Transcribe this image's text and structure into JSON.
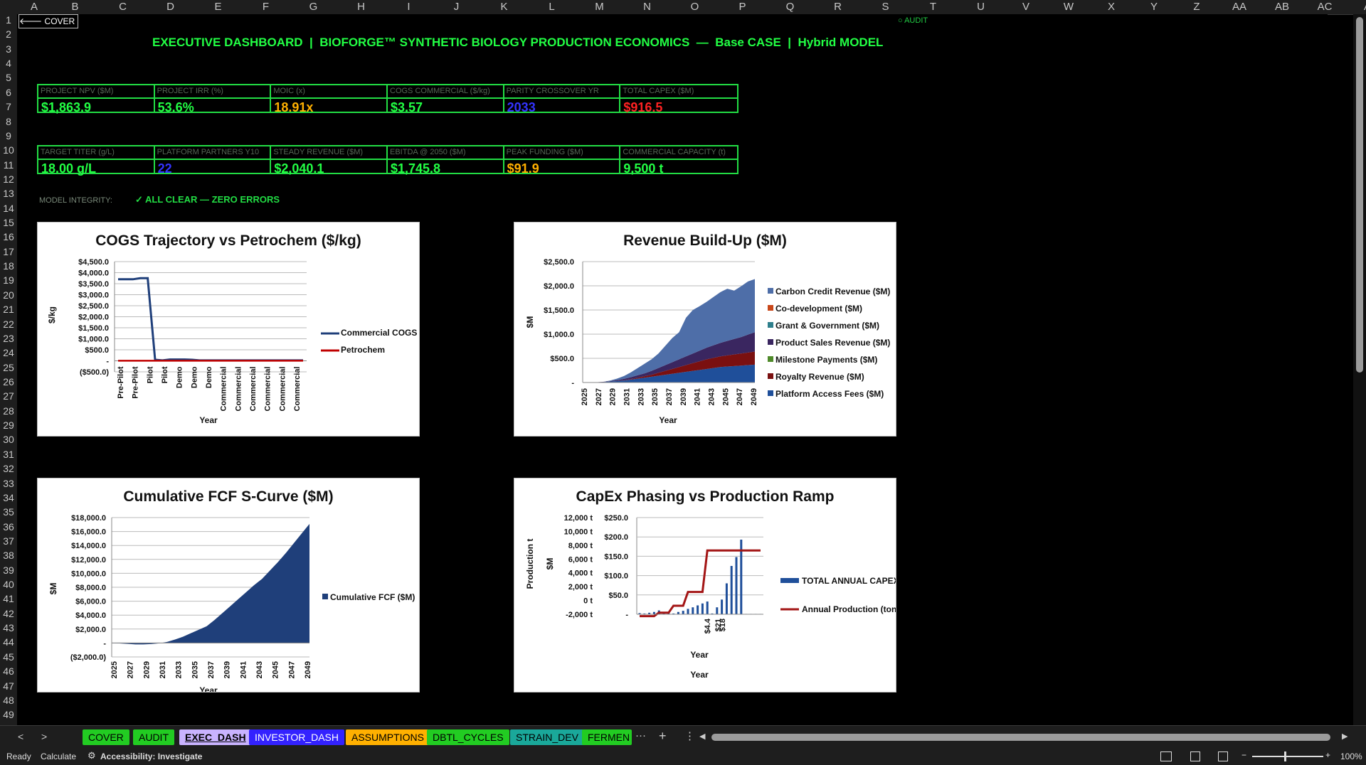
{
  "columns": [
    "A",
    "B",
    "C",
    "D",
    "E",
    "F",
    "G",
    "H",
    "I",
    "J",
    "K",
    "L",
    "M",
    "N",
    "O",
    "P",
    "Q",
    "R",
    "S",
    "T",
    "U",
    "V",
    "W",
    "X",
    "Y",
    "Z",
    "AA",
    "AB",
    "AC",
    "A"
  ],
  "rows": [
    "1",
    "2",
    "3",
    "4",
    "5",
    "6",
    "7",
    "8",
    "9",
    "10",
    "11",
    "12",
    "13",
    "14",
    "15",
    "16",
    "17",
    "18",
    "19",
    "20",
    "21",
    "22",
    "23",
    "24",
    "25",
    "26",
    "27",
    "28",
    "29",
    "30",
    "31",
    "32",
    "33",
    "34",
    "35",
    "36",
    "37",
    "38",
    "39",
    "40",
    "41",
    "42",
    "43",
    "44",
    "45",
    "46",
    "47",
    "48",
    "49"
  ],
  "nav": {
    "back_label": "COVER",
    "audit_label": "○ AUDIT"
  },
  "title": "EXECUTIVE DASHBOARD  |  BIOFORGE™ SYNTHETIC BIOLOGY PRODUCTION ECONOMICS  —  Base CASE  |  Hybrid MODEL",
  "kpi_row1": [
    {
      "label": "PROJECT NPV ($M)",
      "value": "$1,863.9",
      "color": "#22ff44"
    },
    {
      "label": "PROJECT IRR (%)",
      "value": "53.6%",
      "color": "#22ff44"
    },
    {
      "label": "MOIC (x)",
      "value": "18.91x",
      "color": "#ffb000"
    },
    {
      "label": "COGS COMMERCIAL ($/kg)",
      "value": "$3.57",
      "color": "#22ff44"
    },
    {
      "label": "PARITY CROSSOVER YR",
      "value": "2033",
      "color": "#3333ff"
    },
    {
      "label": "TOTAL CAPEX ($M)",
      "value": "$916.5",
      "color": "#ff2222"
    }
  ],
  "kpi_row2": [
    {
      "label": "TARGET TITER (g/L)",
      "value": "18.00 g/L",
      "color": "#22ff44"
    },
    {
      "label": "PLATFORM PARTNERS Y10",
      "value": "22",
      "color": "#3333ff"
    },
    {
      "label": "STEADY REVENUE ($M)",
      "value": "$2,040.1",
      "color": "#22ff44"
    },
    {
      "label": "EBITDA @ 2050 ($M)",
      "value": "$1,745.8",
      "color": "#22ff44"
    },
    {
      "label": "PEAK FUNDING ($M)",
      "value": "$91.9",
      "color": "#ffb000"
    },
    {
      "label": "COMMERCIAL CAPACITY (t)",
      "value": "9,500 t",
      "color": "#22ff44"
    }
  ],
  "integrity": {
    "label": "MODEL INTEGRITY:",
    "value": "✓ ALL CLEAR — ZERO ERRORS"
  },
  "colors": {
    "green": "#22ff44",
    "navy": "#1f3f7a",
    "red": "#c00000",
    "accent": "#22dd44"
  },
  "chart_data": [
    {
      "type": "line",
      "title": "COGS Trajectory vs Petrochem ($/kg)",
      "xlabel": "Year",
      "ylabel": "$/kg",
      "ylim": [
        -500,
        4500
      ],
      "y_ticks": [
        "$4,500.0",
        "$4,000.0",
        "$3,500.0",
        "$3,000.0",
        "$2,500.0",
        "$2,000.0",
        "$1,500.0",
        "$1,000.0",
        "$500.0",
        "-",
        "($500.0)"
      ],
      "categories": [
        "Pre-Pilot",
        "Pre-Pilot",
        "Pilot",
        "Pilot",
        "Demo",
        "Demo",
        "Demo",
        "Commercial",
        "Commercial",
        "Commercial",
        "Commercial",
        "Commercial",
        "Commercial"
      ],
      "legend_position": "right",
      "series": [
        {
          "name": "Commercial COGS",
          "color": "#1f3f7a",
          "values": [
            3700,
            3700,
            3700,
            3750,
            3750,
            50,
            20,
            60,
            60,
            60,
            50,
            20,
            20,
            20,
            20,
            20,
            20,
            20,
            20,
            20,
            20,
            20,
            20,
            20,
            20,
            20
          ]
        },
        {
          "name": "Petrochem",
          "color": "#c00000",
          "values": [
            3,
            3,
            3,
            3,
            3,
            3,
            3,
            3,
            3,
            3,
            3,
            3,
            3,
            3,
            3,
            3,
            3,
            3,
            3,
            3,
            3,
            3,
            3,
            3,
            3,
            3
          ]
        }
      ]
    },
    {
      "type": "area",
      "title": "Revenue Build-Up ($M)",
      "xlabel": "Year",
      "ylabel": "$M",
      "ylim": [
        0,
        2500
      ],
      "y_ticks": [
        "$2,500.0",
        "$2,000.0",
        "$1,500.0",
        "$1,000.0",
        "$500.0",
        "-"
      ],
      "categories": [
        "2025",
        "2027",
        "2029",
        "2031",
        "2033",
        "2035",
        "2037",
        "2039",
        "2041",
        "2043",
        "2045",
        "2047",
        "2049"
      ],
      "legend_position": "right",
      "series": [
        {
          "name": "Carbon Credit Revenue ($M)",
          "color": "#4e6ea8",
          "values": [
            0,
            0,
            0,
            0,
            10,
            30,
            60,
            100,
            150,
            200,
            240,
            300,
            400,
            500,
            560,
            800,
            900,
            920,
            950,
            1000,
            1050,
            1080,
            1000,
            1050,
            1100,
            1100
          ]
        },
        {
          "name": "Co-development ($M)",
          "color": "#c8471a",
          "values": [
            0,
            0,
            0,
            0,
            0,
            0,
            0,
            0,
            0,
            0,
            0,
            0,
            0,
            0,
            0,
            0,
            0,
            0,
            0,
            0,
            0,
            0,
            0,
            0,
            0,
            0
          ]
        },
        {
          "name": "Grant & Government ($M)",
          "color": "#2e7f8c",
          "values": [
            0,
            0,
            0,
            0,
            0,
            0,
            0,
            0,
            0,
            0,
            0,
            0,
            0,
            0,
            0,
            0,
            0,
            0,
            0,
            0,
            0,
            0,
            0,
            0,
            0,
            0
          ]
        },
        {
          "name": "Product Sales Revenue ($M)",
          "color": "#3a2660",
          "values": [
            0,
            0,
            0,
            5,
            10,
            20,
            30,
            40,
            50,
            60,
            80,
            100,
            120,
            140,
            160,
            180,
            200,
            220,
            240,
            260,
            280,
            300,
            320,
            340,
            370,
            400
          ]
        },
        {
          "name": "Milestone Payments ($M)",
          "color": "#4f8a2a",
          "values": [
            0,
            0,
            0,
            0,
            0,
            0,
            0,
            0,
            0,
            0,
            0,
            0,
            0,
            0,
            0,
            0,
            0,
            0,
            0,
            0,
            0,
            0,
            0,
            0,
            0,
            0
          ]
        },
        {
          "name": "Royalty Revenue ($M)",
          "color": "#7a1010",
          "values": [
            0,
            0,
            0,
            0,
            0,
            0,
            5,
            10,
            20,
            30,
            40,
            60,
            80,
            100,
            120,
            140,
            160,
            180,
            200,
            210,
            220,
            230,
            240,
            250,
            260,
            270
          ]
        },
        {
          "name": "Platform Access Fees ($M)",
          "color": "#1f4f9a",
          "values": [
            0,
            2,
            5,
            10,
            20,
            30,
            40,
            60,
            80,
            100,
            120,
            140,
            160,
            180,
            200,
            220,
            240,
            260,
            280,
            300,
            320,
            330,
            340,
            350,
            360,
            370
          ]
        }
      ]
    },
    {
      "type": "area",
      "title": "Cumulative FCF S-Curve ($M)",
      "xlabel": "Year",
      "ylabel": "$M",
      "ylim": [
        -2000,
        18000
      ],
      "y_ticks": [
        "$18,000.0",
        "$16,000.0",
        "$14,000.0",
        "$12,000.0",
        "$10,000.0",
        "$8,000.0",
        "$6,000.0",
        "$4,000.0",
        "$2,000.0",
        "-",
        "($2,000.0)"
      ],
      "categories": [
        "2025",
        "2027",
        "2029",
        "2031",
        "2033",
        "2035",
        "2037",
        "2039",
        "2041",
        "2043",
        "2045",
        "2047",
        "2049"
      ],
      "legend_position": "right",
      "series": [
        {
          "name": "Cumulative FCF ($M)",
          "color": "#1f3f7a",
          "values": [
            -20,
            -60,
            -120,
            -200,
            -200,
            -150,
            -50,
            150,
            500,
            900,
            1400,
            1900,
            2400,
            3300,
            4300,
            5300,
            6300,
            7300,
            8300,
            9200,
            10400,
            11600,
            12900,
            14300,
            15700,
            17100
          ]
        }
      ]
    },
    {
      "type": "bar",
      "title": "CapEx Phasing vs Production Ramp",
      "xlabel": "Year",
      "ylabel": "$M",
      "y2label": "Production t",
      "ylim": [
        0,
        250
      ],
      "y_ticks": [
        "$250.0",
        "$200.0",
        "$150.0",
        "$100.0",
        "$50.0",
        "-"
      ],
      "y2lim": [
        -2000,
        12000
      ],
      "y2_ticks": [
        "12,000 t",
        "10,000 t",
        "8,000 t",
        "6,000 t",
        "4,000 t",
        "2,000 t",
        "0 t",
        "-2,000 t"
      ],
      "x_labels": [
        "$4.4",
        "$21",
        "$18"
      ],
      "legend_position": "right",
      "series": [
        {
          "name": "TOTAL ANNUAL CAPEX ($M)",
          "color": "#1f4f9a",
          "values": [
            3,
            2,
            4,
            6,
            10,
            2,
            3,
            2,
            6,
            9,
            14,
            18,
            23,
            28,
            33,
            2,
            18,
            38,
            80,
            125,
            148,
            193,
            1,
            1,
            1,
            1
          ]
        },
        {
          "name": "Annual Production (tonnes)",
          "color": "#a31515",
          "values": [
            0,
            0,
            0,
            0,
            500,
            500,
            500,
            1500,
            1500,
            1500,
            3500,
            3500,
            3500,
            3500,
            9500,
            9500,
            9500,
            9500,
            9500,
            9500,
            9500,
            9500,
            9500,
            9500,
            9500,
            9500
          ]
        }
      ]
    }
  ],
  "tabs": [
    {
      "label": "COVER",
      "bg": "#22cc22",
      "fg": "#000000"
    },
    {
      "label": "AUDIT",
      "bg": "#22cc22",
      "fg": "#000000"
    },
    {
      "label": "EXEC_DASH",
      "bg": "#c9b3ff",
      "fg": "#000000",
      "active": true
    },
    {
      "label": "INVESTOR_DASH",
      "bg": "#3322ff",
      "fg": "#ffffff"
    },
    {
      "label": "ASSUMPTIONS",
      "bg": "#ffb000",
      "fg": "#000000"
    },
    {
      "label": "DBTL_CYCLES",
      "bg": "#22cc22",
      "fg": "#000000"
    },
    {
      "label": "STRAIN_DEV",
      "bg": "#1aa89a",
      "fg": "#000000"
    },
    {
      "label": "FERMEN",
      "bg": "#22cc22",
      "fg": "#000000"
    }
  ],
  "status": {
    "ready": "Ready",
    "calculate": "Calculate",
    "accessibility": "Accessibility: Investigate",
    "zoom": "100%"
  }
}
